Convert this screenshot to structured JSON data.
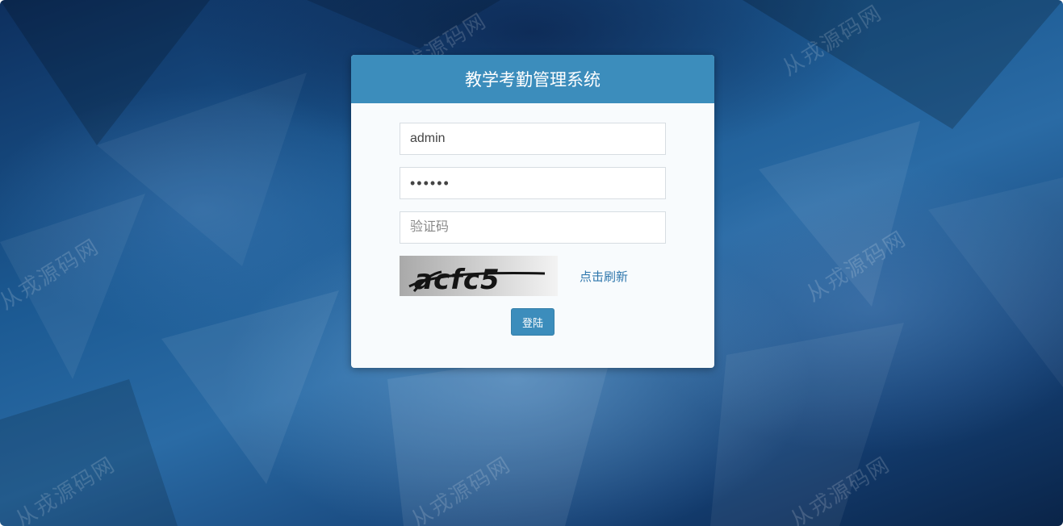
{
  "login": {
    "title": "教学考勤管理系统",
    "username_value": "admin",
    "password_value": "123456",
    "captcha_placeholder": "验证码",
    "captcha_text": "acfc5",
    "refresh_label": "点击刷新",
    "submit_label": "登陆"
  },
  "watermark": {
    "text": "从戎源码网"
  },
  "colors": {
    "header": "#3c8dbc",
    "panel": "#f8fbfd",
    "link": "#2f77ad",
    "background": "#1c5a93"
  }
}
